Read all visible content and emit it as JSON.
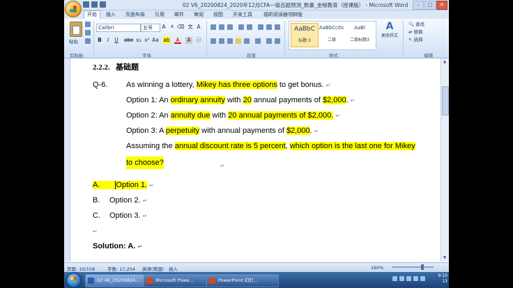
{
  "window": {
    "title": "02 V6_20200824_2020年12月CFA一级百题预测_数量_金程教育（授课版） - Microsoft Word"
  },
  "ribbon": {
    "tabs": [
      "开始",
      "插入",
      "页面布局",
      "引用",
      "邮件",
      "审阅",
      "视图",
      "开发工具",
      "福昕阅读器领鲜版"
    ],
    "active_tab": "开始",
    "paste_label": "粘贴",
    "font_name": "Calibri",
    "font_size": "五号",
    "groups": [
      "剪贴板",
      "字体",
      "段落",
      "样式",
      "编辑"
    ],
    "styles": [
      {
        "preview": "AaBbC",
        "name": "标题 3"
      },
      {
        "preview": "AaBbCcDc",
        "name": "二级"
      },
      {
        "preview": "AaBl",
        "name": "二级标题3"
      }
    ],
    "change_styles": "更改样式",
    "edit_items": [
      "查找",
      "替换",
      "选择"
    ]
  },
  "doc": {
    "section_num": "2.2.2.",
    "section_title": "基础题",
    "q_num": "Q-6.",
    "intro": {
      "a": "As winning a lottery, ",
      "b": "Mikey has three options",
      "c": " to get bonus."
    },
    "opt1": {
      "a": "Option 1: An ",
      "b": "ordinary annuity",
      "c": " with ",
      "d": "20",
      "e": " annual payments of ",
      "f": "$2,000",
      "g": "."
    },
    "opt2": {
      "a": "Option 2: An ",
      "b": "annuity due",
      "c": " with ",
      "d": "20 annual payments of $2,000."
    },
    "opt3": {
      "a": "Option 3: A ",
      "b": "perpetuity",
      "c": " with annual payments of ",
      "d": "$2,000",
      "e": "."
    },
    "ask1": {
      "a": "Assuming the ",
      "b": "annual discount rate is 5 percent",
      "c": ", ",
      "d": "which option is the last one for Mikey"
    },
    "ask2": "to choose?",
    "choices": [
      {
        "letter": "A.",
        "text": "Option 1."
      },
      {
        "letter": "B.",
        "text": "Option 2."
      },
      {
        "letter": "C.",
        "text": "Option 3."
      }
    ],
    "solution": "Solution: A.",
    "para_mark": "↵"
  },
  "status": {
    "page": "页面: 10/158",
    "words": "字数: 17,254",
    "lang": "英语(美国)",
    "insert": "插入",
    "zoom": "160%"
  },
  "taskbar": {
    "items": [
      "02 V6_20200824...",
      "Microsoft Powe...",
      "PowerPoint 幻灯..."
    ],
    "time": "9:10",
    "date": "13"
  }
}
